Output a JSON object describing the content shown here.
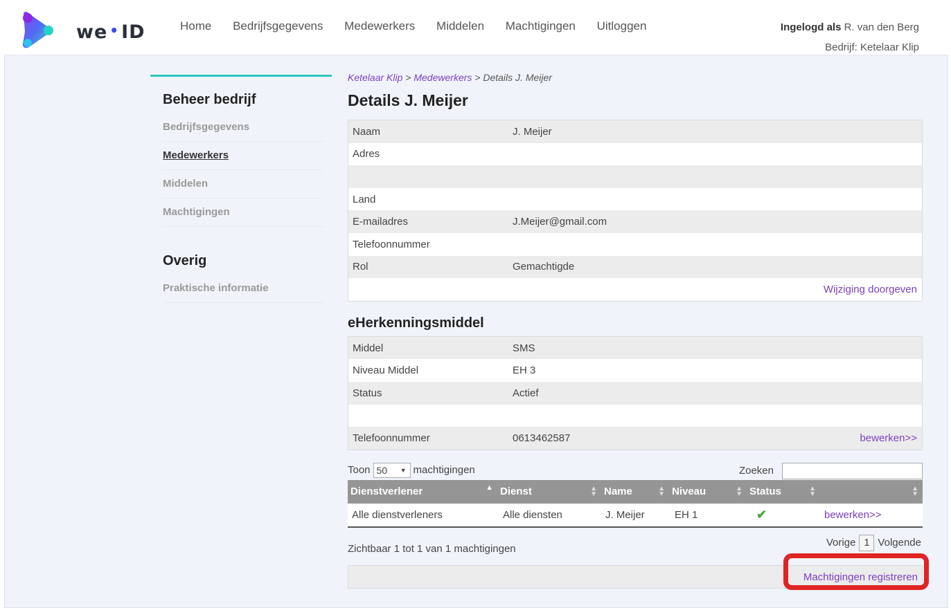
{
  "header": {
    "logo_text_left": "we",
    "logo_text_right": "ID",
    "nav": [
      "Home",
      "Bedrijfsgegevens",
      "Medewerkers",
      "Middelen",
      "Machtigingen",
      "Uitloggen"
    ],
    "logged_in_label": "Ingelogd als",
    "logged_in_user": "R. van den Berg",
    "company_line": "Bedrijf: Ketelaar Klip"
  },
  "sidebar": {
    "heading1": "Beheer bedrijf",
    "items1": [
      "Bedrijfsgegevens",
      "Medewerkers",
      "Middelen",
      "Machtigingen"
    ],
    "active_item": "Medewerkers",
    "heading2": "Overig",
    "items2": [
      "Praktische informatie"
    ]
  },
  "breadcrumb": {
    "crumb1": "Ketelaar Klip",
    "sep1": " > ",
    "crumb2": "Medewerkers",
    "sep2": " > ",
    "current": "Details J. Meijer"
  },
  "page_title": "Details J. Meijer",
  "details": {
    "rows": [
      {
        "k": "Naam",
        "v": "J. Meijer"
      },
      {
        "k": "Adres",
        "v": ""
      },
      {
        "k": "",
        "v": ""
      },
      {
        "k": "Land",
        "v": ""
      },
      {
        "k": "E-mailadres",
        "v": "J.Meijer@gmail.com"
      },
      {
        "k": "Telefoonnummer",
        "v": ""
      },
      {
        "k": "Rol",
        "v": "Gemachtigde"
      }
    ],
    "change_link": "Wijziging doorgeven"
  },
  "eh": {
    "title": "eHerkenningsmiddel",
    "rows": [
      {
        "k": "Middel",
        "v": "SMS"
      },
      {
        "k": "Niveau Middel",
        "v": "EH 3"
      },
      {
        "k": "Status",
        "v": "Actief"
      },
      {
        "k": "",
        "v": ""
      }
    ],
    "phone_label": "Telefoonnummer",
    "phone_value": "0613462587",
    "edit_link": "bewerken>>"
  },
  "table_controls": {
    "show_label": "Toon",
    "page_size": "50",
    "unit_label": "machtigingen",
    "search_label": "Zoeken"
  },
  "grid": {
    "headers": [
      "Dienstverlener",
      "Dienst",
      "Name",
      "Niveau",
      "Status",
      ""
    ],
    "rows": [
      {
        "provider": "Alle dienstverleners",
        "service": "Alle diensten",
        "name": "J. Meijer",
        "level": "EH 1",
        "status_icon": "check-icon",
        "action": "bewerken>>"
      }
    ],
    "status_color": "#4caa3c"
  },
  "footer": {
    "info": "Zichtbaar 1 tot 1 van 1 machtigingen",
    "prev": "Vorige",
    "page": "1",
    "next": "Volgende",
    "register_link": "Machtigingen registreren"
  },
  "colors": {
    "accent_teal": "#29c7c0",
    "link_purple": "#7b3fbf",
    "highlight_red": "#e02424"
  }
}
